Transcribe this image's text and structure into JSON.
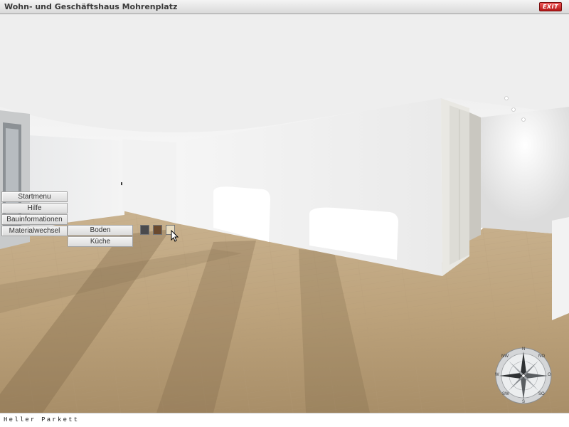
{
  "window": {
    "title": "Wohn- und Geschäftshaus Mohrenplatz",
    "exit_label": "EXIT"
  },
  "menu": {
    "items": [
      {
        "label": "Startmenu"
      },
      {
        "label": "Hilfe"
      },
      {
        "label": "Bauinformationen"
      },
      {
        "label": "Materialwechsel"
      }
    ],
    "submenu": [
      {
        "label": "Boden"
      },
      {
        "label": "Küche"
      }
    ],
    "material_swatches": [
      {
        "name": "dark",
        "color": "#4a4a4d"
      },
      {
        "name": "brown",
        "color": "#6b4a2e"
      },
      {
        "name": "light",
        "color": "#e8dcc0"
      }
    ]
  },
  "compass": {
    "labels": [
      "N",
      "NO",
      "O",
      "SO",
      "S",
      "SW",
      "W",
      "NW"
    ]
  },
  "status": {
    "text": "Heller Parkett"
  }
}
